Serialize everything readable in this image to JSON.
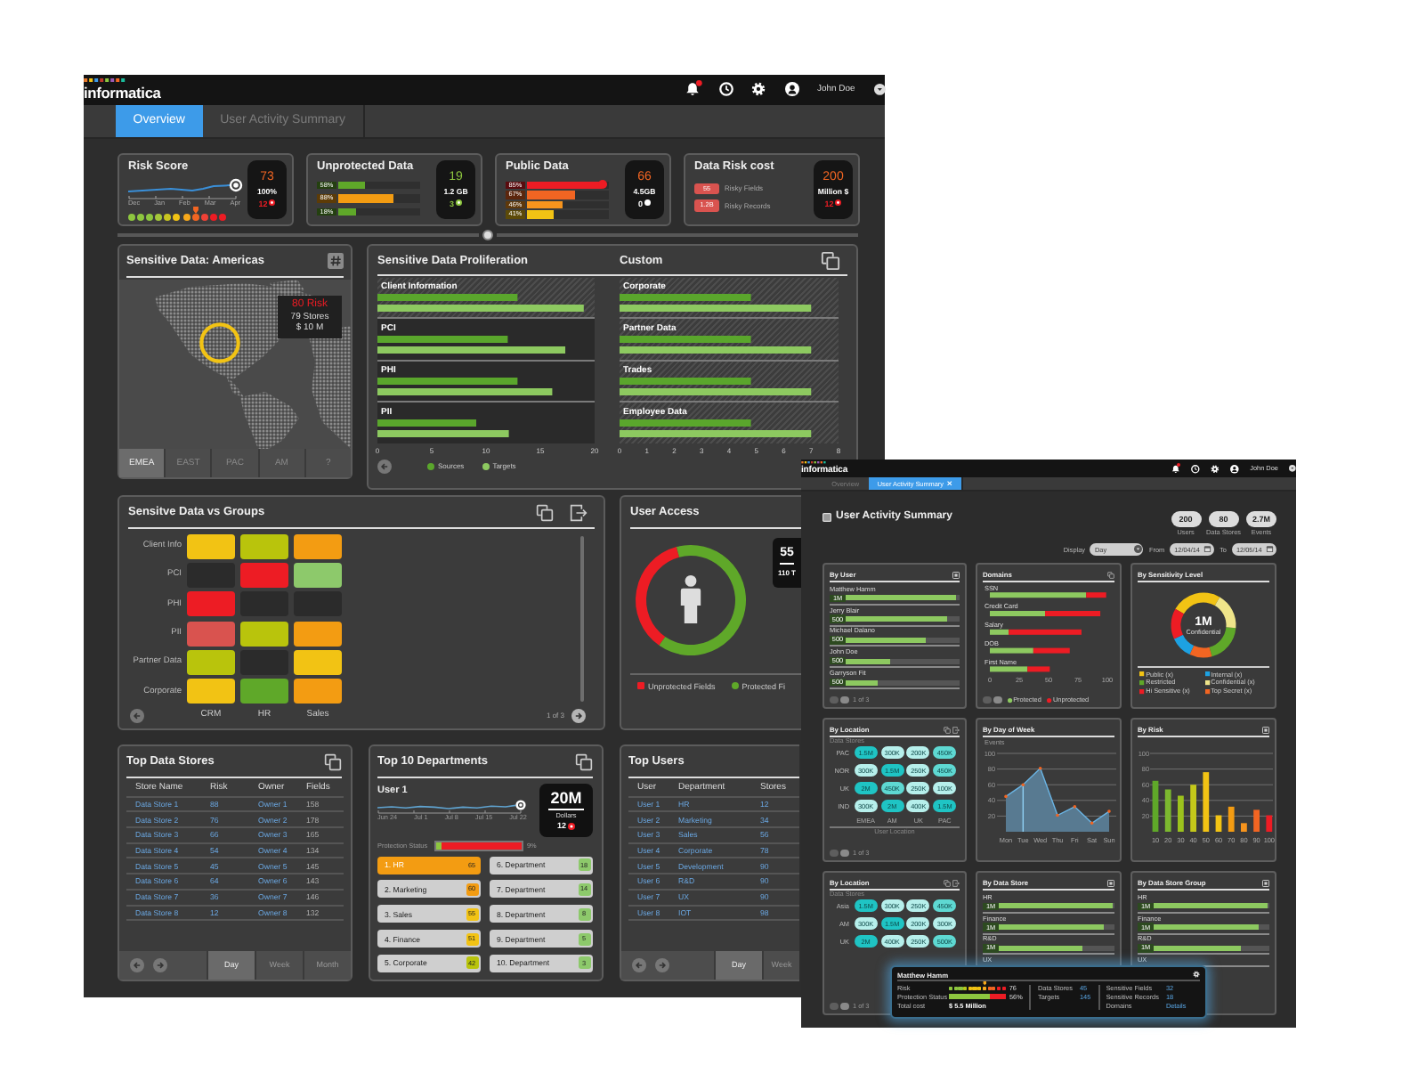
{
  "main_window": {
    "header": {
      "logo": "informatica",
      "user": "John Doe",
      "notification": true
    },
    "tabs": [
      {
        "label": "Overview",
        "selected": true
      },
      {
        "label": "User Activity Summary",
        "selected": false
      }
    ],
    "kpis": [
      {
        "kind": "trend",
        "title": "Risk Score",
        "value": "73",
        "color": "#f26522",
        "detail": "100%",
        "alert": {
          "count": "12",
          "color": "#ed1c24"
        },
        "months": [
          "Dec",
          "Jan",
          "Feb",
          "Mar",
          "Apr"
        ],
        "scale": [
          {
            "color": "#8dc63f",
            "selected": false
          },
          {
            "color": "#8dc63f",
            "selected": false
          },
          {
            "color": "#8dc63f",
            "selected": false
          },
          {
            "color": "#a5c83a",
            "selected": false
          },
          {
            "color": "#c8c520",
            "selected": false
          },
          {
            "color": "#f2c314",
            "selected": false
          },
          {
            "color": "#f7a81b",
            "selected": false
          },
          {
            "color": "#f26522",
            "selected": true
          },
          {
            "color": "#ef4136",
            "selected": false
          },
          {
            "color": "#ed1c24",
            "selected": false
          },
          {
            "color": "#ed1c24",
            "selected": false
          }
        ]
      },
      {
        "kind": "bars",
        "title": "Unprotected Data",
        "value": "19",
        "color": "#8dc63f",
        "detail": "1.2 GB",
        "alert": {
          "count": "3",
          "color": "#8dc63f"
        },
        "bars": [
          {
            "label": "58%",
            "level": 0.33,
            "color": "#5fa829",
            "knob": false
          },
          {
            "label": "88%",
            "level": 0.67,
            "color": "#f39c12",
            "knob": false
          },
          {
            "label": "18%",
            "level": 0.21,
            "color": "#5fa829",
            "knob": false
          }
        ]
      },
      {
        "kind": "bars",
        "title": "Public Data",
        "value": "66",
        "color": "#f26522",
        "detail": "4.5GB",
        "alert": {
          "count": "0",
          "color": "#ffffff"
        },
        "bars": [
          {
            "label": "85%",
            "level": 0.92,
            "color": "#ed1c24",
            "knob": true
          },
          {
            "label": "67%",
            "level": 0.58,
            "color": "#f26522",
            "knob": false
          },
          {
            "label": "46%",
            "level": 0.44,
            "color": "#f7941d",
            "knob": false
          },
          {
            "label": "41%",
            "level": 0.33,
            "color": "#f2c314",
            "knob": false
          }
        ]
      },
      {
        "kind": "cost",
        "title": "Data Risk cost",
        "value": "200",
        "color": "#f26522",
        "detail": "Million $",
        "alert": {
          "count": "12",
          "color": "#ed1c24"
        },
        "items": [
          {
            "badge": "55",
            "label": "Risky Fields"
          },
          {
            "badge": "1.2B",
            "label": "Risky Records"
          }
        ]
      }
    ],
    "map": {
      "title": "Sensitive Data: Americas",
      "tooltip": {
        "risk": "80 Risk",
        "stores": "79 Stores",
        "amount": "$ 10 M"
      },
      "regions": [
        {
          "label": "EMEA",
          "selected": true
        },
        {
          "label": "EAST",
          "selected": false
        },
        {
          "label": "PAC",
          "selected": false
        },
        {
          "label": "AM",
          "selected": false
        },
        {
          "label": "?",
          "selected": false
        }
      ]
    },
    "proliferation": {
      "title": "Sensitive Data Proliferation",
      "charts": [
        {
          "row_highlight": [
            true,
            false,
            false,
            false
          ],
          "chart_data": {
            "type": "bar",
            "orientation": "horizontal",
            "categories": [
              "Client Information",
              "PCI",
              "PHI",
              "PII"
            ],
            "series": [
              {
                "name": "Sources",
                "color": "#5aa62c",
                "values": [
                  12.9,
                  12.0,
                  12.9,
                  9.1
                ]
              },
              {
                "name": "Targets",
                "color": "#8dc960",
                "values": [
                  19.0,
                  17.3,
                  16.1,
                  12.1
                ]
              }
            ],
            "xlim": [
              0,
              20
            ],
            "xticks": [
              0,
              5,
              10,
              15,
              20
            ]
          }
        },
        {
          "heading": "Custom",
          "row_highlight": [
            true,
            true,
            true,
            true
          ],
          "chart_data": {
            "type": "bar",
            "orientation": "horizontal",
            "categories": [
              "Corporate",
              "Partner Data",
              "Trades",
              "Employee Data"
            ],
            "series": [
              {
                "color": "#5aa62c",
                "values": [
                  4.8,
                  4.8,
                  4.8,
                  4.8
                ]
              },
              {
                "color": "#8dc960",
                "values": [
                  7,
                  7,
                  7,
                  7
                ]
              }
            ],
            "xlim": [
              0,
              8
            ],
            "xticks": [
              0,
              1,
              2,
              3,
              4,
              5,
              6,
              7,
              8
            ]
          }
        }
      ]
    },
    "groups": {
      "title": "Sensitve Data vs Groups",
      "columns": [
        "CRM",
        "HR",
        "Sales"
      ],
      "rows": [
        {
          "label": "Client Info",
          "cells": [
            {
              "color": "#f2c314"
            },
            {
              "color": "#b9c40c"
            },
            {
              "color": "#f39c12"
            }
          ]
        },
        {
          "label": "PCI",
          "cells": [
            {
              "color": "#2b2b2b"
            },
            {
              "color": "#ed1c24"
            },
            {
              "color": "#8dc96b"
            }
          ]
        },
        {
          "label": "PHI",
          "cells": [
            {
              "color": "#ed1c24"
            },
            {
              "color": "#2b2b2b"
            },
            {
              "color": "#2b2b2b"
            }
          ]
        },
        {
          "label": "PII",
          "cells": [
            {
              "color": "#d9534f"
            },
            {
              "color": "#b9c40c"
            },
            {
              "color": "#f39c12"
            }
          ]
        },
        {
          "label": "Partner Data",
          "cells": [
            {
              "color": "#b9c40c"
            },
            {
              "color": "#2b2b2b"
            },
            {
              "color": "#f2c314"
            }
          ]
        },
        {
          "label": "Corporate",
          "cells": [
            {
              "color": "#f2c314"
            },
            {
              "color": "#5fa829"
            },
            {
              "color": "#f39c12"
            }
          ]
        }
      ],
      "pager": "1 of 3"
    },
    "user_access": {
      "title": "User Access",
      "callout": {
        "value": "55",
        "detail": "110 T"
      },
      "legend": [
        {
          "label": "Unprotected Fields",
          "color": "#ed1c24"
        },
        {
          "label": "Protected Fi",
          "color": "#5fa829"
        }
      ]
    },
    "data_stores": {
      "title": "Top Data Stores",
      "columns": [
        "Store Name",
        "Risk",
        "Owner",
        "Fields"
      ],
      "rows": [
        [
          "Data Store 1",
          "88",
          "Owner 1",
          "158"
        ],
        [
          "Data Store 2",
          "76",
          "Owner 2",
          "178"
        ],
        [
          "Data Store 3",
          "66",
          "Owner 3",
          "165"
        ],
        [
          "Data Store 4",
          "54",
          "Owner 4",
          "134"
        ],
        [
          "Data Store 5",
          "45",
          "Owner 5",
          "145"
        ],
        [
          "Data Store 6",
          "64",
          "Owner 6",
          "143"
        ],
        [
          "Data Store 7",
          "36",
          "Owner 7",
          "146"
        ],
        [
          "Data Store 8",
          "12",
          "Owner 8",
          "132"
        ]
      ],
      "periods": [
        {
          "label": "Day",
          "selected": true
        },
        {
          "label": "Week",
          "selected": false
        },
        {
          "label": "Month",
          "selected": false
        }
      ]
    },
    "departments": {
      "title": "Top 10 Departments",
      "user": "User 1",
      "dates": [
        "Jun 24",
        "Jul 1",
        "Jul 8",
        "Jul 15",
        "Jul 22"
      ],
      "callout": {
        "value": "20M",
        "unit": "Dollars",
        "alert": {
          "count": "12",
          "color": "#ed1c24"
        }
      },
      "protection": {
        "label": "Protection Status",
        "level": 0.07,
        "reading": "9%"
      },
      "items": [
        {
          "label": "1. HR",
          "value": "65",
          "color": "#f39c12",
          "selected": true
        },
        {
          "label": "2. Marketing",
          "value": "60",
          "color": "#f39c12",
          "selected": false
        },
        {
          "label": "3. Sales",
          "value": "55",
          "color": "#f2c314",
          "selected": false
        },
        {
          "label": "4. Finance",
          "value": "51",
          "color": "#f2c314",
          "selected": false
        },
        {
          "label": "5. Corporate",
          "value": "42",
          "color": "#b9c40c",
          "selected": false
        },
        {
          "label": "6. Department",
          "value": "18",
          "color": "#8dc96b",
          "selected": false
        },
        {
          "label": "7. Department",
          "value": "14",
          "color": "#8dc96b",
          "selected": false
        },
        {
          "label": "8. Department",
          "value": "8",
          "color": "#8dc96b",
          "selected": false
        },
        {
          "label": "9. Department",
          "value": "5",
          "color": "#8dc96b",
          "selected": false
        },
        {
          "label": "10. Department",
          "value": "3",
          "color": "#8dc96b",
          "selected": false
        }
      ]
    },
    "top_users": {
      "title": "Top Users",
      "columns": [
        "User",
        "Department",
        "Stores"
      ],
      "rows": [
        [
          "User 1",
          "HR",
          "12"
        ],
        [
          "User 2",
          "Marketing",
          "34"
        ],
        [
          "User 3",
          "Sales",
          "56"
        ],
        [
          "User 4",
          "Corporate",
          "78"
        ],
        [
          "User 5",
          "Development",
          "90"
        ],
        [
          "User 6",
          "R&D",
          "90"
        ],
        [
          "User 7",
          "UX",
          "90"
        ],
        [
          "User 8",
          "IOT",
          "98"
        ]
      ],
      "periods": [
        {
          "label": "Day",
          "selected": true
        },
        {
          "label": "Week",
          "selected": false
        }
      ]
    }
  },
  "activity_window": {
    "header": {
      "logo": "informatica",
      "user": "John Doe",
      "notification": true
    },
    "tabs": [
      {
        "label": "Overview",
        "selected": false,
        "closable": false
      },
      {
        "label": "User Activity Summary",
        "selected": true,
        "closable": true
      }
    ],
    "title": "User Activity Summary",
    "stats": [
      {
        "value": "200",
        "label": "Users"
      },
      {
        "value": "80",
        "label": "Data Stores"
      },
      {
        "value": "2.7M",
        "label": "Events"
      }
    ],
    "filters": [
      {
        "kind": "select",
        "label": "Display",
        "value": "Day"
      },
      {
        "kind": "date",
        "label": "From",
        "value": "12/04/14"
      },
      {
        "kind": "date",
        "label": "To",
        "value": "12/05/14"
      }
    ],
    "panels": [
      {
        "kind": "bar_list",
        "title": "By User",
        "rows": [
          {
            "name": "Matthew Hamm",
            "badge": "1M",
            "level": 0.97
          },
          {
            "name": "Jerry Blair",
            "badge": "500",
            "level": 0.89
          },
          {
            "name": "Michael Dalano",
            "badge": "500",
            "level": 0.71
          },
          {
            "name": "John Doe",
            "badge": "500",
            "level": 0.39
          },
          {
            "name": "Garryson Fit",
            "badge": "500",
            "level": 0.28
          }
        ],
        "pager": "1 of 3"
      },
      {
        "kind": "stacked",
        "title": "Domains",
        "chart_data": {
          "type": "bar",
          "orientation": "horizontal",
          "stacked": true,
          "categories": [
            "SSN",
            "Credit Card",
            "Salary",
            "DOB",
            "First Name"
          ],
          "series": [
            {
              "name": "Protected",
              "color": "#8dc960",
              "values": [
                82,
                47,
                16,
                37,
                32
              ]
            },
            {
              "name": "Unprotected",
              "color": "#ed1c24",
              "values": [
                17,
                47,
                62,
                31,
                19
              ]
            }
          ],
          "xlim": [
            0,
            100
          ],
          "xticks": [
            0,
            25,
            50,
            75,
            100
          ]
        }
      },
      {
        "kind": "donut",
        "title": "By Sensitivity Level",
        "center_value": "1M",
        "center_label": "Confidential",
        "legend": [
          {
            "label": "Public (x)",
            "color": "#f2c314"
          },
          {
            "label": "Internal (x)",
            "color": "#1da1e2"
          },
          {
            "label": "Restricted",
            "color": "#5fa829"
          },
          {
            "label": "Confidential (x)",
            "color": "#efe58a"
          },
          {
            "label": "Hi Sensitive (x)",
            "color": "#ed1c24"
          },
          {
            "label": "Top Secret (x)",
            "color": "#f26522"
          }
        ]
      },
      {
        "kind": "heatmap",
        "title": "By Location",
        "row_axis": "Data Stores",
        "rows": [
          {
            "label": "PAC",
            "cells": [
              {
                "value": "1.5M",
                "color": "#1fc4c4"
              },
              {
                "value": "300K",
                "color": "#b6efeb"
              },
              {
                "value": "200K",
                "color": "#b6efeb"
              },
              {
                "value": "450K",
                "color": "#5ed8d2"
              }
            ]
          },
          {
            "label": "NOR",
            "cells": [
              {
                "value": "300K",
                "color": "#b6efeb"
              },
              {
                "value": "1.5M",
                "color": "#1fc4c4"
              },
              {
                "value": "250K",
                "color": "#b6efeb"
              },
              {
                "value": "450K",
                "color": "#5ed8d2"
              }
            ]
          },
          {
            "label": "UK",
            "cells": [
              {
                "value": "2M",
                "color": "#1fc4c4"
              },
              {
                "value": "450K",
                "color": "#5ed8d2"
              },
              {
                "value": "250K",
                "color": "#b6efeb"
              },
              {
                "value": "100K",
                "color": "#b6efeb"
              }
            ]
          },
          {
            "label": "IND",
            "cells": [
              {
                "value": "300K",
                "color": "#b6efeb"
              },
              {
                "value": "2M",
                "color": "#1fc4c4"
              },
              {
                "value": "400K",
                "color": "#b6efeb"
              },
              {
                "value": "1.5M",
                "color": "#1fc4c4"
              }
            ]
          }
        ],
        "x_labels": [
          "EMEA",
          "AM",
          "UK",
          "PAC"
        ],
        "column_axis": "User Location",
        "pager": "1 of 3"
      },
      {
        "kind": "area",
        "title": "By Day of Week",
        "highlighted": [
          false,
          true,
          false,
          false,
          false,
          false,
          false
        ],
        "chart_data": {
          "type": "area",
          "ylabel": "Events",
          "categories": [
            "Mon",
            "Tue",
            "Wed",
            "Thu",
            "Fri",
            "Sat",
            "Sun"
          ],
          "values": [
            45,
            60,
            81,
            21,
            32,
            11,
            26
          ],
          "ylim": [
            0,
            100
          ],
          "yticks": [
            20,
            40,
            60,
            80,
            100
          ],
          "grid": true
        }
      },
      {
        "kind": "bars",
        "title": "By Risk",
        "bars": [
          {
            "color": "#5fa829"
          },
          {
            "color": "#7cb82f"
          },
          {
            "color": "#9cc21d"
          },
          {
            "color": "#c4c81a"
          },
          {
            "color": "#f2c314"
          },
          {
            "color": "#f2c314"
          },
          {
            "color": "#f39c12"
          },
          {
            "color": "#f7941d"
          },
          {
            "color": "#f26522"
          },
          {
            "color": "#ed1c24"
          }
        ],
        "chart_data": {
          "type": "bar",
          "categories": [
            "10",
            "20",
            "30",
            "40",
            "50",
            "60",
            "70",
            "80",
            "90",
            "100"
          ],
          "values": [
            65,
            54,
            46,
            60,
            76,
            21,
            32,
            11,
            28,
            21
          ],
          "ylim": [
            0,
            100
          ],
          "yticks": [
            20,
            40,
            60,
            80,
            100
          ],
          "grid": true
        }
      },
      {
        "kind": "heatmap",
        "title": "By Location",
        "row_axis": "Data Stores",
        "rows": [
          {
            "label": "Asia",
            "cells": [
              {
                "value": "1.5M",
                "color": "#1fc4c4"
              },
              {
                "value": "300K",
                "color": "#b6efeb"
              },
              {
                "value": "250K",
                "color": "#b6efeb"
              },
              {
                "value": "450K",
                "color": "#5ed8d2"
              }
            ]
          },
          {
            "label": "AM",
            "cells": [
              {
                "value": "300K",
                "color": "#b6efeb"
              },
              {
                "value": "1.5M",
                "color": "#1fc4c4"
              },
              {
                "value": "200K",
                "color": "#b6efeb"
              },
              {
                "value": "300K",
                "color": "#b6efeb"
              }
            ]
          },
          {
            "label": "UK",
            "cells": [
              {
                "value": "2M",
                "color": "#1fc4c4"
              },
              {
                "value": "400K",
                "color": "#b6efeb"
              },
              {
                "value": "250K",
                "color": "#b6efeb"
              },
              {
                "value": "500K",
                "color": "#5ed8d2"
              }
            ]
          }
        ],
        "pager": "1 of 3"
      },
      {
        "kind": "bar_list",
        "title": "By Data Store",
        "rows": [
          {
            "name": "HR",
            "badge": "1M",
            "level": 0.98
          },
          {
            "name": "Finance",
            "badge": "1M",
            "level": 0.9
          },
          {
            "name": "R&D",
            "badge": "1M",
            "level": 0.73
          },
          {
            "name": "UX"
          }
        ]
      },
      {
        "kind": "bar_list",
        "title": "By Data Store Group",
        "rows": [
          {
            "name": "HR",
            "badge": "1M",
            "level": 0.98
          },
          {
            "name": "Finance",
            "badge": "1M",
            "level": 0.91
          },
          {
            "name": "R&D",
            "badge": "1M",
            "level": 0.75
          },
          {
            "name": "UX"
          }
        ]
      }
    ],
    "tooltip": {
      "name": "Matthew Hamm",
      "metrics": [
        {
          "kind": "scale",
          "label": "Risk",
          "reading": "76",
          "scale": [
            {
              "color": "#8dc63f",
              "selected": false
            },
            {
              "color": "#8dc63f",
              "selected": false
            },
            {
              "color": "#8dc63f",
              "selected": false
            },
            {
              "color": "#b5c81a",
              "selected": false
            },
            {
              "color": "#f2c314",
              "selected": false
            },
            {
              "color": "#f2c314",
              "selected": false
            },
            {
              "color": "#f2c314",
              "selected": false
            },
            {
              "color": "#f7a81b",
              "selected": true
            },
            {
              "color": "#f26522",
              "selected": false
            },
            {
              "color": "#f26522",
              "selected": false
            },
            {
              "color": "#ed1c24",
              "selected": false
            },
            {
              "color": "#ed1c24",
              "selected": false
            }
          ]
        },
        {
          "kind": "bar",
          "label": "Protection Status",
          "level": 0.71,
          "reading": "56%"
        },
        {
          "kind": "text",
          "label": "Total cost",
          "value": "$ 5.5 Million"
        }
      ],
      "stats": [
        [
          {
            "label": "Data Stores",
            "value": "45"
          },
          {
            "label": "Targets",
            "value": "145"
          }
        ],
        [
          {
            "label": "Sensitive Fields",
            "value": "32"
          },
          {
            "label": "Sensitive Records",
            "value": "18"
          },
          {
            "label": "Domains",
            "value": "Details"
          }
        ]
      ]
    }
  }
}
